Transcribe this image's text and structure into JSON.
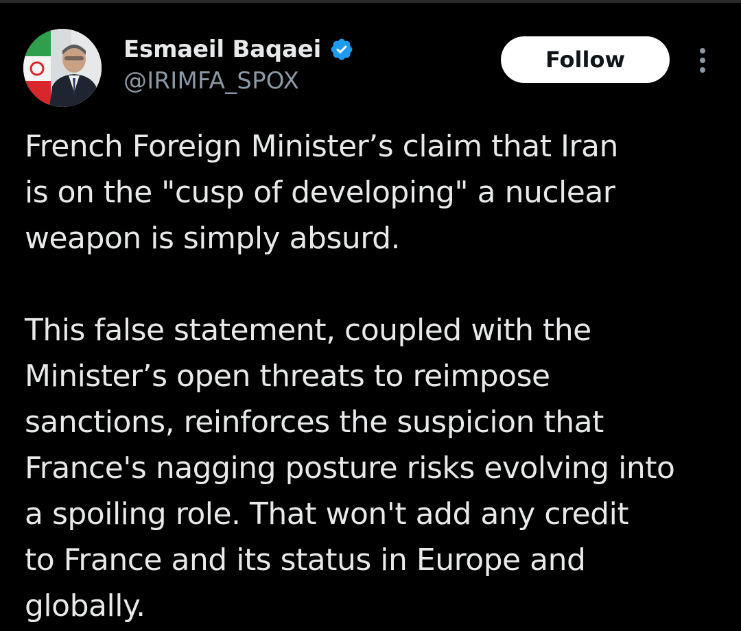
{
  "author": {
    "display_name": "Esmaeil Baqaei",
    "handle": "@IRIMFA_SPOX",
    "verified": true,
    "avatar_icon": "profile-photo-with-iran-flag"
  },
  "actions": {
    "follow_label": "Follow",
    "more_icon": "vertical-ellipsis-icon"
  },
  "tweet": {
    "paragraph_1": [
      "French Foreign Minister’s claim that Iran",
      "is on the \"cusp of developing\" a nuclear",
      "weapon is simply absurd."
    ],
    "paragraph_2": [
      "This false statement, coupled with the",
      "Minister’s open threats to reimpose",
      "sanctions, reinforces the suspicion that",
      "France's nagging posture risks evolving into",
      "a spoiling role. That won't add any credit",
      "to France and its status in Europe and",
      "globally."
    ]
  },
  "colors": {
    "background": "#000000",
    "text_primary": "#e7e9ea",
    "text_secondary": "#8b98a5",
    "verified_blue": "#1d9bf0",
    "follow_bg": "#ffffff",
    "follow_text": "#0f1419"
  }
}
